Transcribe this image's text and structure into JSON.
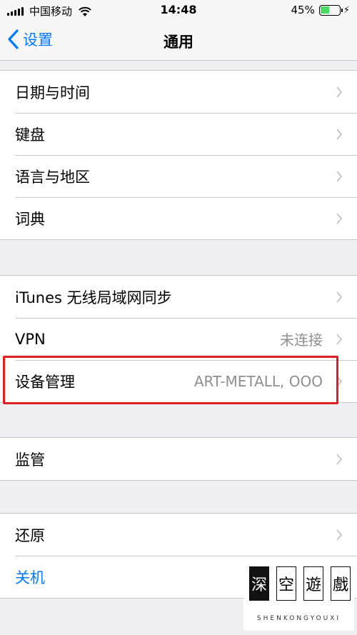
{
  "status_bar": {
    "carrier": "中国移动",
    "time": "14:48",
    "battery_percent": "45%",
    "battery_level": 0.45,
    "battery_color": "#4cd964"
  },
  "nav": {
    "back_label": "设置",
    "title": "通用",
    "accent": "#007aff"
  },
  "groups": [
    {
      "items": [
        {
          "label": "日期与时间"
        },
        {
          "label": "键盘"
        },
        {
          "label": "语言与地区"
        },
        {
          "label": "词典"
        }
      ]
    },
    {
      "items": [
        {
          "label": "iTunes 无线局域网同步"
        },
        {
          "label": "VPN",
          "value": "未连接"
        },
        {
          "label": "设备管理",
          "value": "ART-METALL, OOO"
        }
      ]
    },
    {
      "items": [
        {
          "label": "监管"
        }
      ]
    },
    {
      "items": [
        {
          "label": "还原"
        },
        {
          "label": "关机"
        }
      ]
    }
  ],
  "icons": [
    "signal-icon",
    "wifi-icon",
    "battery-icon",
    "charging-bolt-icon",
    "back-chevron-icon",
    "chevron-right-icon"
  ],
  "watermark": {
    "chars": [
      "深",
      "空",
      "遊",
      "戲"
    ],
    "subtitle": "SHENKONGYOUXI"
  },
  "highlight_color": "#e02020"
}
